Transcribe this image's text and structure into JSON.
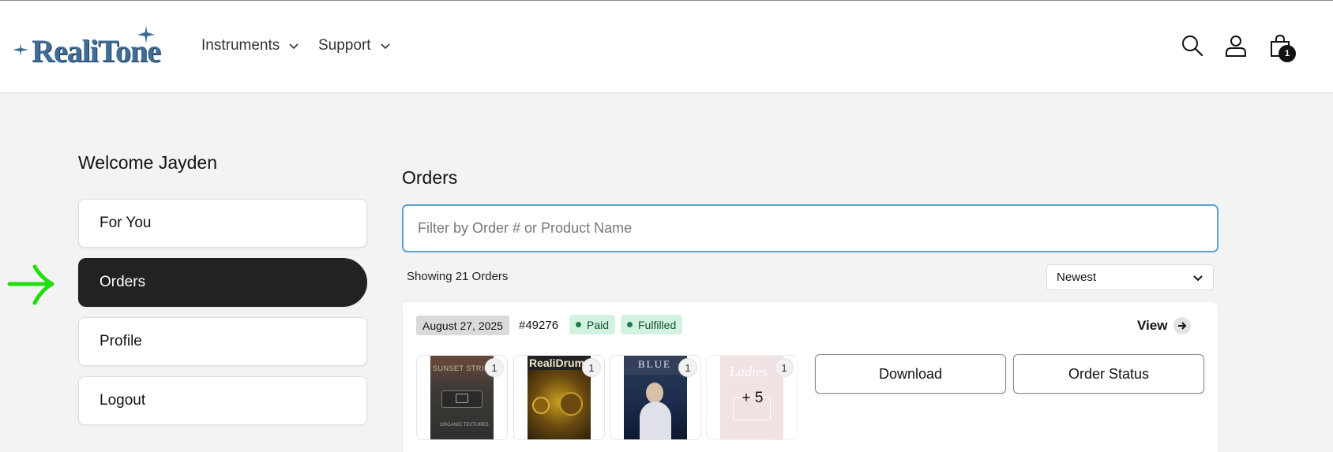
{
  "header": {
    "logo_text": "RealiTone",
    "nav": [
      {
        "label": "Instruments"
      },
      {
        "label": "Support"
      }
    ],
    "cart_count": "1",
    "icons": [
      "search-icon",
      "account-icon",
      "cart-icon",
      "chevron-down-icon"
    ]
  },
  "sidebar": {
    "welcome": "Welcome Jayden",
    "items": [
      {
        "label": "For You"
      },
      {
        "label": "Orders",
        "active": true
      },
      {
        "label": "Profile"
      },
      {
        "label": "Logout"
      }
    ]
  },
  "main": {
    "title": "Orders",
    "search_placeholder": "Filter by Order # or Product Name",
    "showing": "Showing 21 Orders",
    "sort": {
      "selected": "Newest"
    },
    "orders": [
      {
        "date": "August 27, 2025",
        "number": "#49276",
        "payment_status": "Paid",
        "fulfillment_status": "Fulfilled",
        "view_label": "View",
        "products": [
          {
            "title": "SUNSET STRINGS",
            "subtitle": "ORGANIC TEXTURES",
            "qty": "1"
          },
          {
            "title": "RealiDrums",
            "qty": "1"
          },
          {
            "title": "BLUE",
            "qty": "1"
          },
          {
            "title": "Ladies",
            "qty": "1"
          }
        ],
        "more_label": "+ 5",
        "download_label": "Download",
        "status_label": "Order Status"
      }
    ]
  },
  "colors": {
    "accent_arrow": "#22dd11",
    "active_nav_bg": "#222222",
    "search_border": "#5ba4d1",
    "paid_bg": "#d4f2e0",
    "logo": "#3f6d95"
  }
}
